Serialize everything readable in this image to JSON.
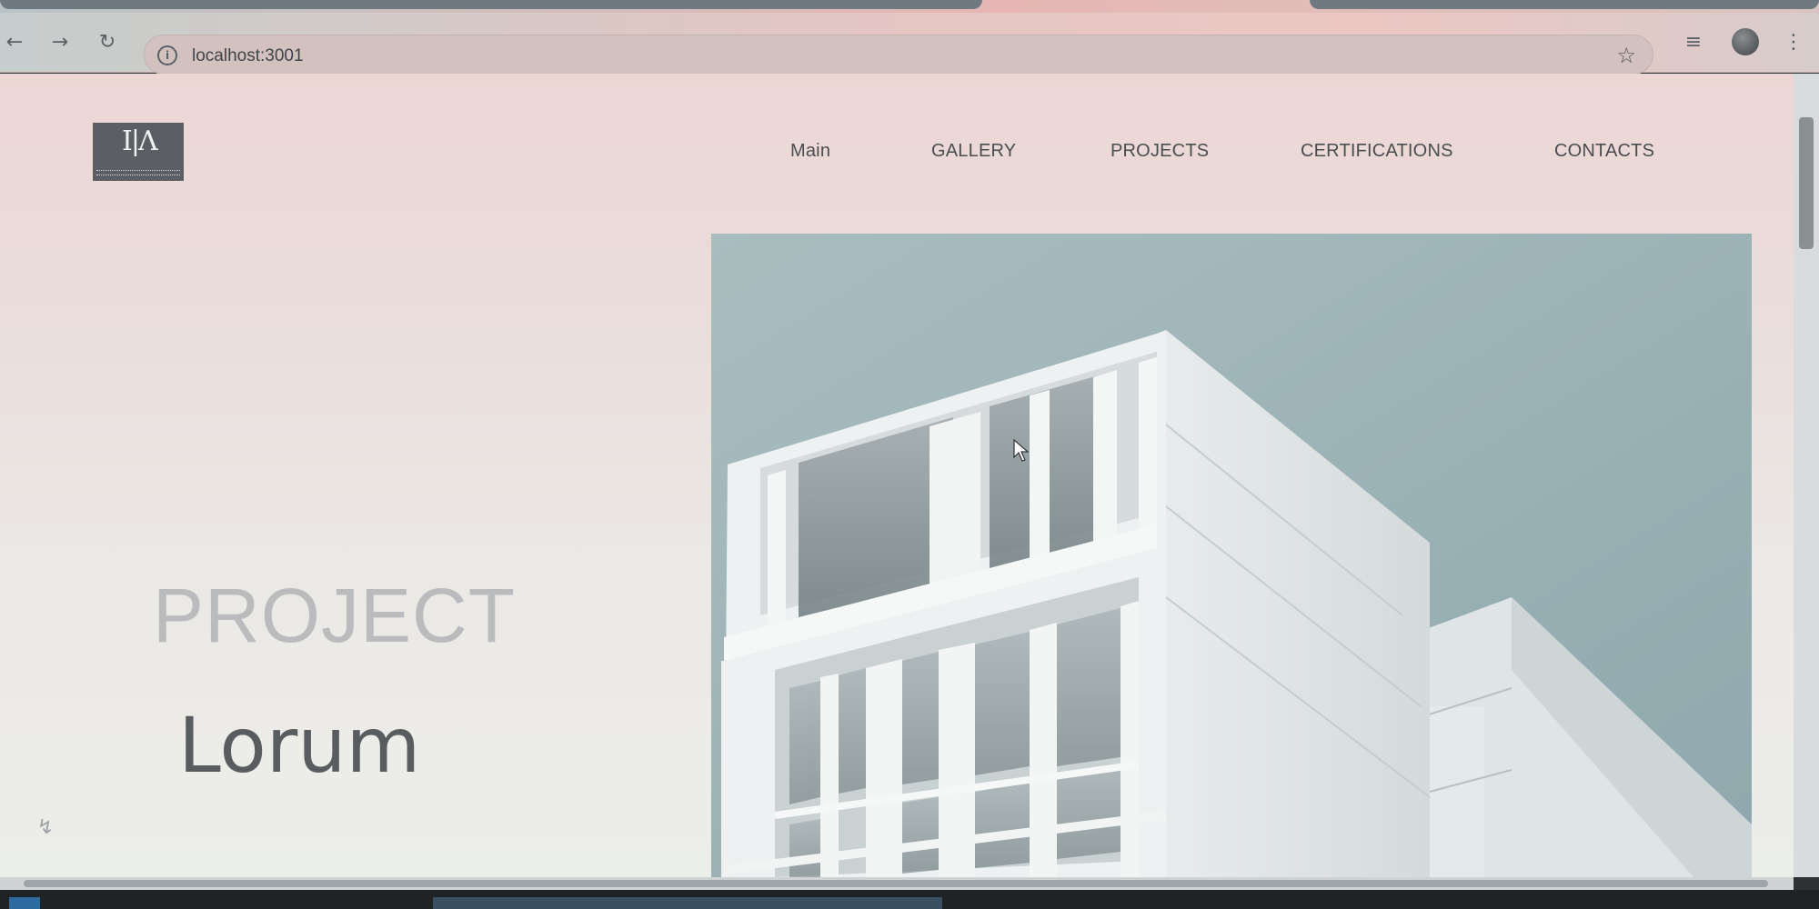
{
  "browser": {
    "url": "localhost:3001",
    "icons": {
      "back": "arrow-left-icon",
      "forward": "arrow-right-icon",
      "reload": "reload-icon",
      "site_info": "info-icon",
      "bookmark": "star-icon",
      "media": "media-playlist-icon",
      "profile": "avatar",
      "menu": "kebab-menu-icon"
    }
  },
  "nav": {
    "items": [
      {
        "label": "Main"
      },
      {
        "label": "GALLERY"
      },
      {
        "label": "PROJECTS"
      },
      {
        "label": "CERTIFICATIONS"
      },
      {
        "label": "CONTACTS"
      }
    ]
  },
  "hero": {
    "label": "PROJECT",
    "title": "Lorum"
  },
  "colors": {
    "page_bg_top": "#ecd7d5",
    "page_bg_bottom": "#eceeea",
    "nav_text": "#4a4d50",
    "hero_label": "#b9bbbd",
    "hero_title": "#5a5d60",
    "sky": "#a8bcbd",
    "building": "#e9eded"
  }
}
